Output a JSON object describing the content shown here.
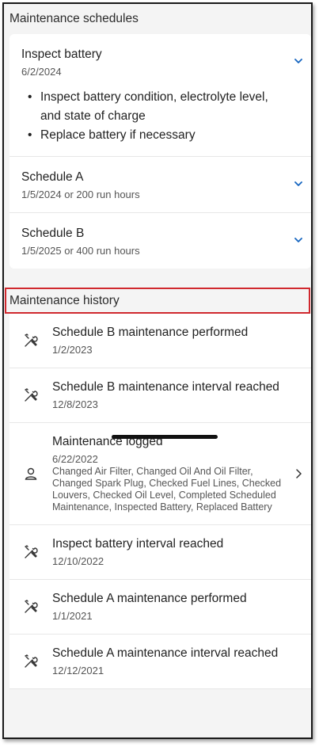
{
  "schedules_header": "Maintenance schedules",
  "schedules": [
    {
      "title": "Inspect battery",
      "date": "6/2/2024",
      "expanded": true,
      "details": [
        "Inspect battery condition, electrolyte level, and state of charge",
        "Replace battery if necessary"
      ]
    },
    {
      "title": "Schedule A",
      "date": "1/5/2024 or 200 run hours",
      "expanded": false
    },
    {
      "title": "Schedule B",
      "date": "1/5/2025 or 400 run hours",
      "expanded": false
    }
  ],
  "history_header": "Maintenance history",
  "history": [
    {
      "icon": "wrench-screwdriver-icon",
      "title": "Schedule B maintenance performed",
      "date": "1/2/2023"
    },
    {
      "icon": "wrench-screwdriver-icon",
      "title": "Schedule B maintenance interval reached",
      "date": "12/8/2023"
    },
    {
      "icon": "person-icon",
      "title": "Maintenance logged",
      "date": "6/22/2022",
      "detail": "Changed Air Filter, Changed Oil And Oil Filter, Changed Spark Plug, Checked Fuel Lines, Checked Louvers, Checked Oil Level, Completed Scheduled Maintenance, Inspected Battery, Replaced Battery"
    },
    {
      "icon": "wrench-screwdriver-icon",
      "title": "Inspect battery interval reached",
      "date": "12/10/2022"
    },
    {
      "icon": "wrench-screwdriver-icon",
      "title": "Schedule A maintenance performed",
      "date": "1/1/2021"
    },
    {
      "icon": "wrench-screwdriver-icon",
      "title": "Schedule A maintenance interval reached",
      "date": "12/12/2021"
    }
  ],
  "colors": {
    "accent": "#1565c0",
    "highlight_border": "#d0282e",
    "background": "#f4f4f4"
  }
}
